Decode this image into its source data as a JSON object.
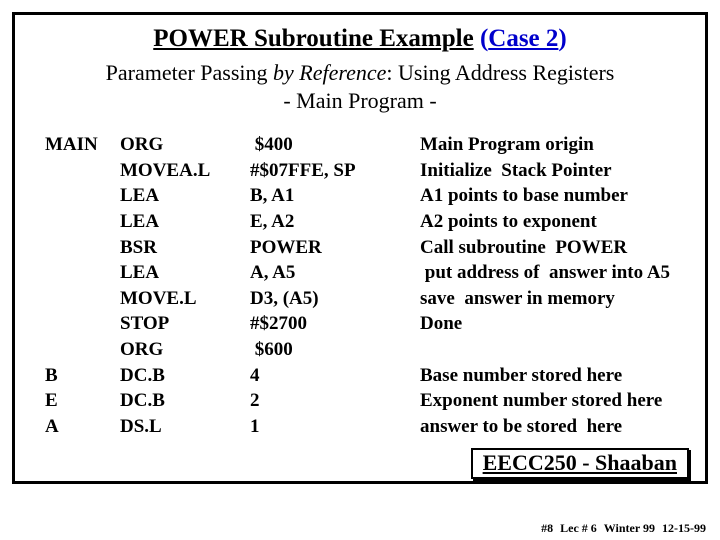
{
  "title": {
    "text_plain": "POWER Subroutine Example",
    "text_case_open": "(",
    "text_case": "Case 2",
    "text_case_close": ")"
  },
  "subtitle": {
    "pre": "Parameter Passing ",
    "emph": "by Reference",
    "post": ": Using Address Registers",
    "line2": "- Main Program -"
  },
  "code": [
    {
      "label": "MAIN",
      "op": "ORG",
      "operand": " $400",
      "comment": "Main Program origin"
    },
    {
      "label": "",
      "op": "MOVEA.L",
      "operand": "#$07FFE, SP",
      "comment": "Initialize  Stack Pointer"
    },
    {
      "label": "",
      "op": "LEA",
      "operand": "B, A1",
      "comment": "A1 points to base number"
    },
    {
      "label": "",
      "op": "LEA",
      "operand": "E, A2",
      "comment": "A2 points to exponent"
    },
    {
      "label": "",
      "op": "BSR",
      "operand": "POWER",
      "comment": "Call subroutine  POWER"
    },
    {
      "label": "",
      "op": "LEA",
      "operand": "A, A5",
      "comment": " put address of  answer into A5"
    },
    {
      "label": "",
      "op": "MOVE.L",
      "operand": "D3, (A5)",
      "comment": "save  answer in memory"
    },
    {
      "label": "",
      "op": "STOP",
      "operand": "#$2700",
      "comment": "Done"
    },
    {
      "label": "",
      "op": "ORG",
      "operand": " $600",
      "comment": ""
    },
    {
      "label": "B",
      "op": "DC.B",
      "operand": "4",
      "comment": "Base number stored here"
    },
    {
      "label": "E",
      "op": "DC.B",
      "operand": "2",
      "comment": "Exponent number stored here"
    },
    {
      "label": "A",
      "op": "DS.L",
      "operand": "1",
      "comment": "answer to be stored  here"
    }
  ],
  "footer_box": "EECC250 - Shaaban",
  "page_footer": {
    "num": "#8",
    "lec": "Lec # 6",
    "term": "Winter 99",
    "date": "12-15-99"
  }
}
